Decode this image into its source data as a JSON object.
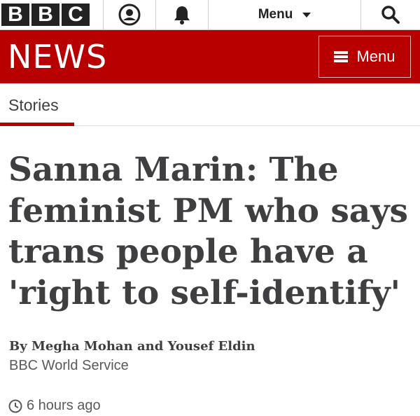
{
  "topbar": {
    "logo_letters": [
      "B",
      "B",
      "C"
    ],
    "account_icon": "account-icon",
    "notifications_icon": "bell-icon",
    "menu_label": "Menu",
    "search_icon": "search-icon"
  },
  "newsbar": {
    "wordmark": "NEWS",
    "menu_label": "Menu",
    "brand_color": "#b80000"
  },
  "section": {
    "label": "Stories"
  },
  "article": {
    "headline": "Sanna Marin: The feminist PM who says trans people have a 'right to self-identify'",
    "byline": "By Megha Mohan and Yousef Eldin",
    "service": "BBC World Service",
    "timestamp": "6 hours ago"
  }
}
